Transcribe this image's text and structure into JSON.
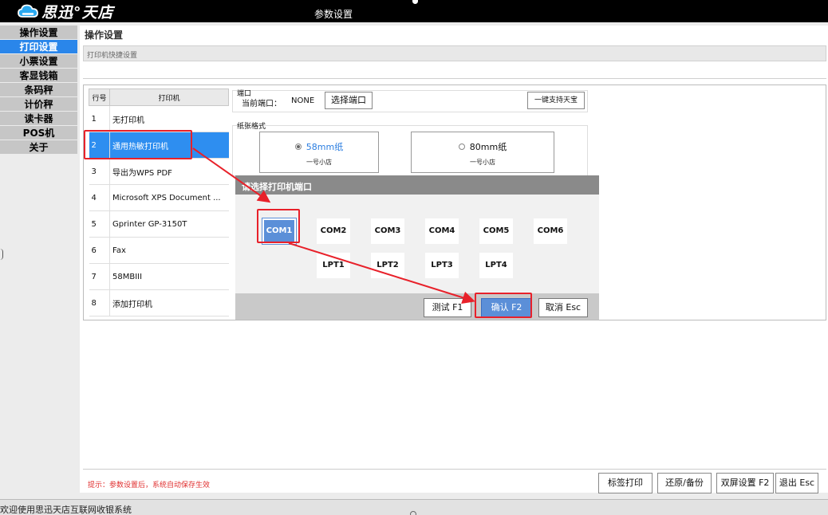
{
  "app": {
    "logo_text": "思迅°天店",
    "window_title": "参数设置"
  },
  "sidebar": {
    "items": [
      {
        "label": "操作设置"
      },
      {
        "label": "打印设置",
        "active": true
      },
      {
        "label": "小票设置"
      },
      {
        "label": "客显钱箱"
      },
      {
        "label": "条码秤"
      },
      {
        "label": "计价秤"
      },
      {
        "label": "读卡器"
      },
      {
        "label": "POS机"
      },
      {
        "label": "关于"
      }
    ]
  },
  "main": {
    "page_title": "操作设置",
    "section_title": "打印机快捷设置"
  },
  "printer_table": {
    "headers": [
      "行号",
      "打印机"
    ],
    "rows": [
      {
        "num": "1",
        "name": "无打印机"
      },
      {
        "num": "2",
        "name": "通用热敏打印机",
        "selected": true
      },
      {
        "num": "3",
        "name": "导出为WPS PDF"
      },
      {
        "num": "4",
        "name": "Microsoft XPS Document ..."
      },
      {
        "num": "5",
        "name": "Gprinter  GP-3150T"
      },
      {
        "num": "6",
        "name": "Fax"
      },
      {
        "num": "7",
        "name": "58MBIII"
      },
      {
        "num": "8",
        "name": "添加打印机"
      }
    ]
  },
  "port": {
    "label": "端口",
    "current_label": "当前端口：",
    "current_value": "NONE",
    "select_button": "选择端口",
    "one_key_button": "一键支持天宝"
  },
  "paper": {
    "label": "纸张格式",
    "options": [
      {
        "name": "58mm纸",
        "sub": "一号小店",
        "checked": true
      },
      {
        "name": "80mm纸",
        "sub": "一号小店",
        "checked": false
      }
    ]
  },
  "dialog": {
    "title": "请选择打印机端口",
    "com_ports": [
      "COM1",
      "COM2",
      "COM3",
      "COM4",
      "COM5",
      "COM6"
    ],
    "lpt_ports": [
      "LPT1",
      "LPT2",
      "LPT3",
      "LPT4"
    ],
    "selected_port": "COM1",
    "test_button": "测试 F1",
    "confirm_button": "确认 F2",
    "cancel_button": "取消 Esc"
  },
  "footer": {
    "hint": "提示：参数设置后，系统自动保存生效",
    "label_print_button": "标签打印",
    "restore_button": "还原/备份",
    "dual_screen_button": "双屏设置 F2",
    "exit_button": "退出 Esc"
  },
  "status": {
    "text": "欢迎使用思迅天店互联网收银系统"
  },
  "colors": {
    "accent": "#2a86ea",
    "selected_row": "#2e8ef0",
    "confirm": "#5b8fd8",
    "annotation": "#e8212a"
  }
}
